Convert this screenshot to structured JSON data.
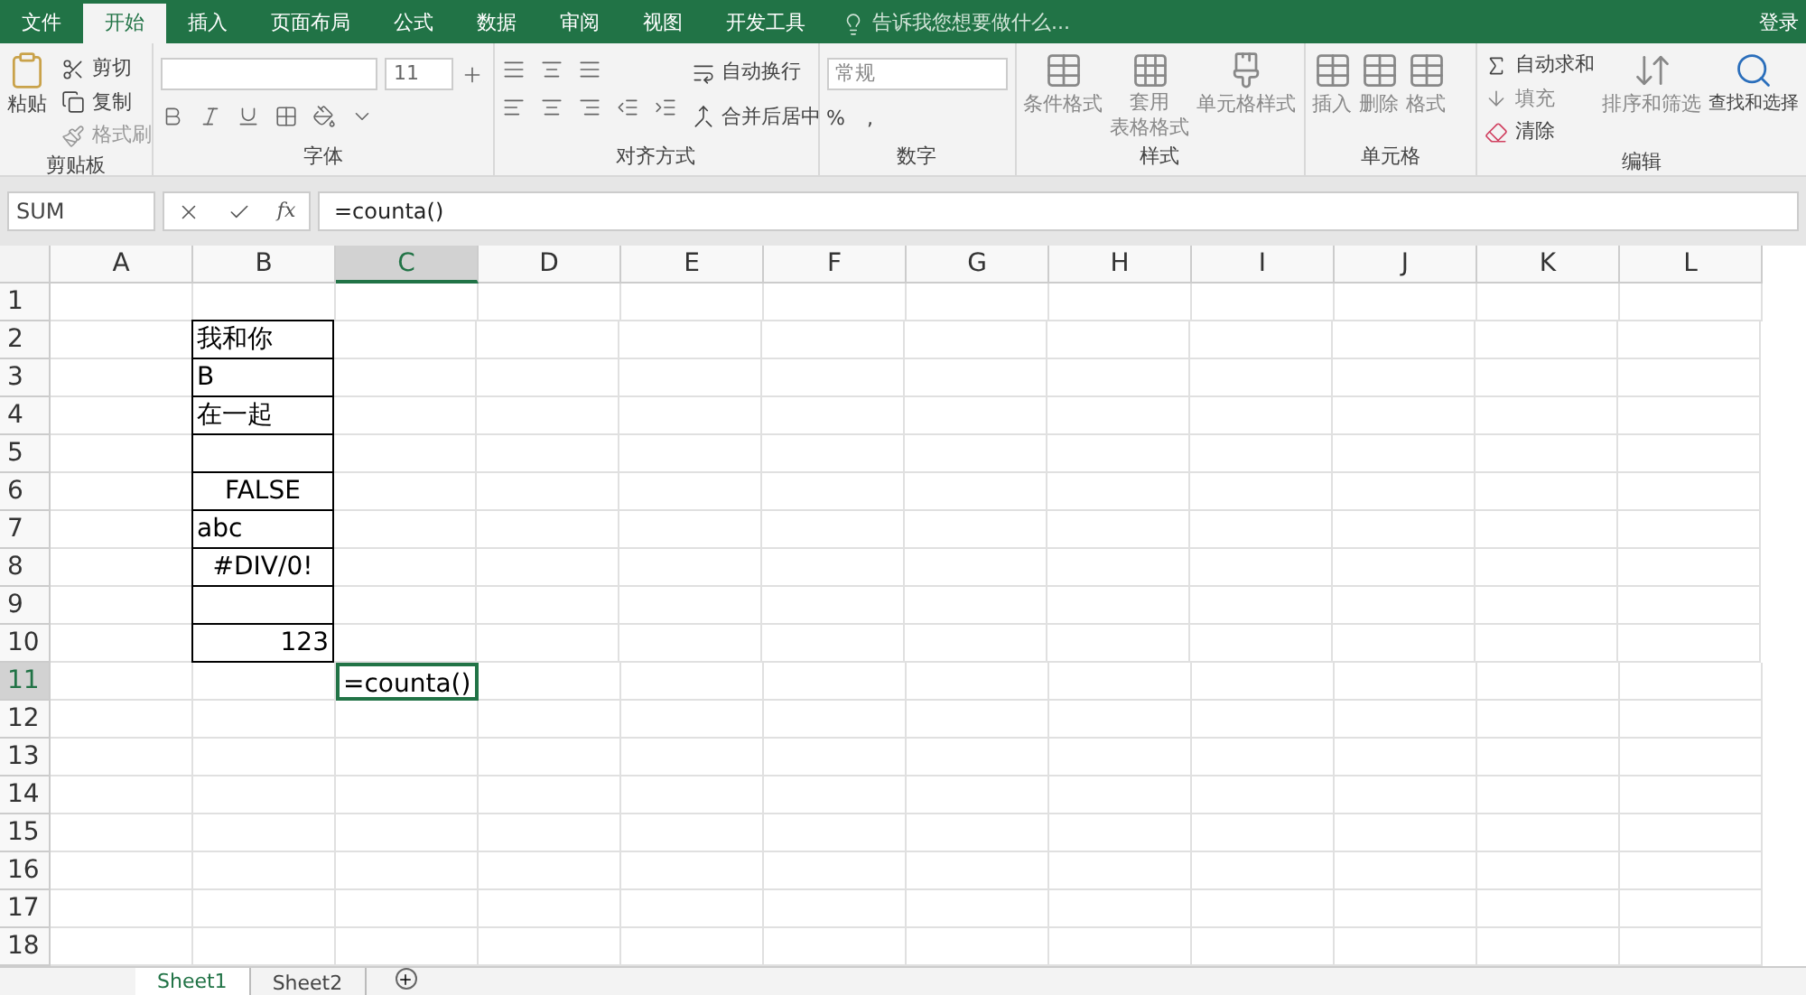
{
  "menu_tabs": [
    {
      "label": "文件",
      "selected": false
    },
    {
      "label": "开始",
      "selected": true
    },
    {
      "label": "插入",
      "selected": false
    },
    {
      "label": "页面布局",
      "selected": false
    },
    {
      "label": "公式",
      "selected": false
    },
    {
      "label": "数据",
      "selected": false
    },
    {
      "label": "审阅",
      "selected": false
    },
    {
      "label": "视图",
      "selected": false
    },
    {
      "label": "开发工具",
      "selected": false
    }
  ],
  "tell_me": {
    "placeholder": "告诉我您想要做什么..."
  },
  "login": "登录",
  "clipboard": {
    "label": "剪贴板",
    "paste": "粘贴",
    "cut": "剪切",
    "copy": "复制",
    "format_painter": "格式刷"
  },
  "font": {
    "label": "字体",
    "size": "11"
  },
  "alignment": {
    "label": "对齐方式",
    "wrap": "自动换行",
    "merge": "合并后居中"
  },
  "number": {
    "label": "数字",
    "format": "常规",
    "percent": "%",
    "comma": ","
  },
  "styles": {
    "label": "样式",
    "conditional": "条件格式",
    "table": [
      "套用",
      "表格格式"
    ],
    "cell_styles": "单元格样式"
  },
  "cells": {
    "label": "单元格",
    "insert": "插入",
    "delete": "删除",
    "format": "格式"
  },
  "editing": {
    "label": "编辑",
    "autosum": "自动求和",
    "fill": "填充",
    "clear": "清除",
    "sort": "排序和筛选",
    "find": "查找和选择"
  },
  "name_box": "SUM",
  "function_label": "fx",
  "formula": "=counta()",
  "columns": [
    {
      "label": "A",
      "selected": false
    },
    {
      "label": "B",
      "selected": false
    },
    {
      "label": "C",
      "selected": true
    },
    {
      "label": "D",
      "selected": false
    },
    {
      "label": "E",
      "selected": false
    },
    {
      "label": "F",
      "selected": false
    },
    {
      "label": "G",
      "selected": false
    },
    {
      "label": "H",
      "selected": false
    },
    {
      "label": "I",
      "selected": false
    },
    {
      "label": "J",
      "selected": false
    },
    {
      "label": "K",
      "selected": false
    },
    {
      "label": "L",
      "selected": false
    }
  ],
  "rows": [
    {
      "number": "1",
      "selected": false
    },
    {
      "number": "2",
      "selected": false,
      "b": {
        "text": "我和你",
        "kind": "text",
        "bordered": true
      }
    },
    {
      "number": "3",
      "selected": false,
      "b": {
        "text": "B",
        "kind": "text",
        "bordered": true
      }
    },
    {
      "number": "4",
      "selected": false,
      "b": {
        "text": "在一起",
        "kind": "text",
        "bordered": true
      }
    },
    {
      "number": "5",
      "selected": false,
      "b": {
        "bordered": true
      }
    },
    {
      "number": "6",
      "selected": false,
      "b": {
        "text": "FALSE",
        "kind": "boolean",
        "bordered": true
      }
    },
    {
      "number": "7",
      "selected": false,
      "b": {
        "text": "abc",
        "kind": "text",
        "bordered": true
      }
    },
    {
      "number": "8",
      "selected": false,
      "b": {
        "text": "#DIV/0!",
        "kind": "error",
        "bordered": true
      }
    },
    {
      "number": "9",
      "selected": false,
      "b": {
        "bordered": true
      }
    },
    {
      "number": "10",
      "selected": false,
      "b": {
        "text": "123",
        "kind": "number",
        "bordered": true
      }
    },
    {
      "number": "11",
      "selected": true,
      "c": {
        "text": "=counta()",
        "bordered": false,
        "editing": true
      }
    },
    {
      "number": "12",
      "selected": false
    },
    {
      "number": "13",
      "selected": false
    },
    {
      "number": "14",
      "selected": false
    },
    {
      "number": "15",
      "selected": false
    },
    {
      "number": "16",
      "selected": false
    },
    {
      "number": "17",
      "selected": false
    },
    {
      "number": "18",
      "selected": false
    }
  ],
  "sheets": [
    {
      "label": "Sheet1",
      "selected": true
    },
    {
      "label": "Sheet2",
      "selected": false
    }
  ]
}
